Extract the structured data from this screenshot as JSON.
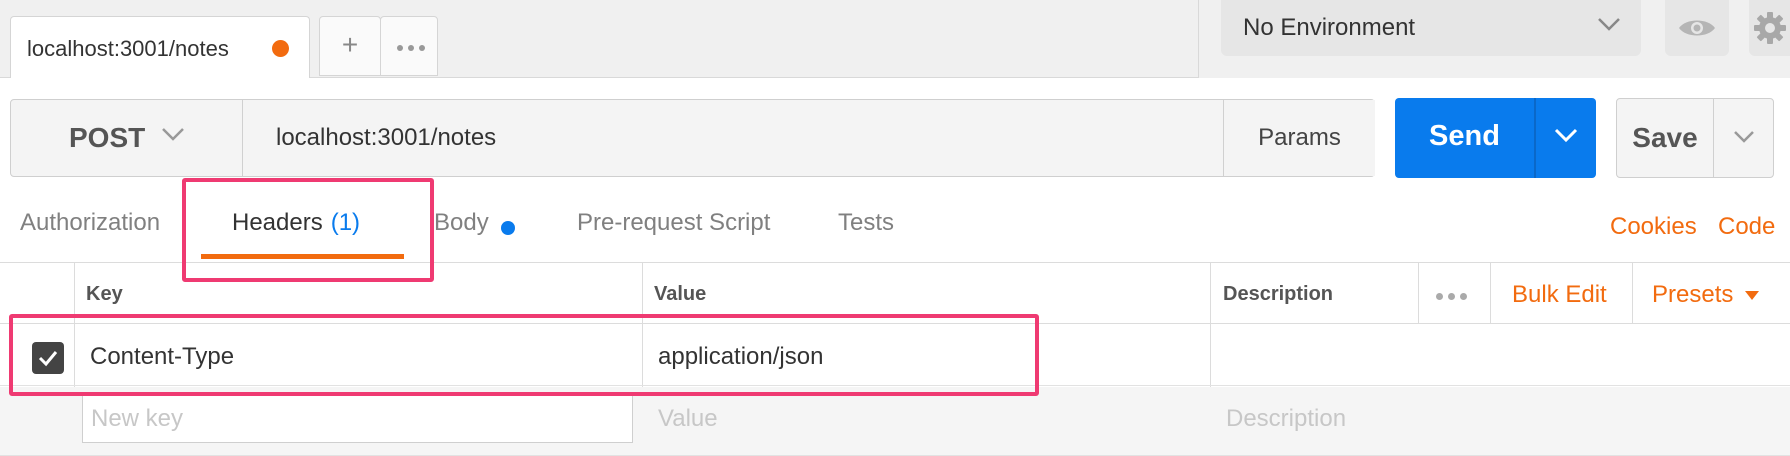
{
  "tab_bar": {
    "request_tab_label": "localhost:3001/notes",
    "unsaved_indicator_color": "#f26b0f",
    "add_tab_label": "+"
  },
  "environment": {
    "selected": "No Environment"
  },
  "request": {
    "method": "POST",
    "url": "localhost:3001/notes",
    "params_label": "Params",
    "send_label": "Send",
    "save_label": "Save"
  },
  "request_tabs": {
    "authorization": "Authorization",
    "headers": "Headers",
    "headers_count": "(1)",
    "body": "Body",
    "pre_request": "Pre-request Script",
    "tests": "Tests",
    "cookies": "Cookies",
    "code": "Code",
    "active": "Headers"
  },
  "headers_table": {
    "columns": {
      "key": "Key",
      "value": "Value",
      "description": "Description"
    },
    "bulk_edit_label": "Bulk Edit",
    "presets_label": "Presets",
    "rows": [
      {
        "enabled": true,
        "key": "Content-Type",
        "value": "application/json",
        "description": ""
      }
    ],
    "new_row": {
      "key_placeholder": "New key",
      "value_placeholder": "Value",
      "description_placeholder": "Description"
    }
  },
  "colors": {
    "accent_orange": "#f26b0f",
    "send_blue": "#097bed",
    "highlight_pink": "#ef3a72"
  }
}
